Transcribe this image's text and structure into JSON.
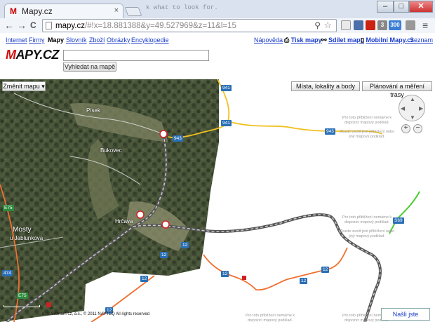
{
  "browser": {
    "tab_favicon": "M",
    "tab_title": "Mapy.cz",
    "tab_close": "×",
    "url_host": "mapy.cz",
    "url_rest": "/#!x=18.881388&y=49.527969&z=11&l=15",
    "win_min": "–",
    "win_max": "□",
    "win_close": "✕",
    "back": "←",
    "forward": "→",
    "reload": "C",
    "menu": "≡",
    "search_icon": "⚲",
    "star_icon": "☆",
    "overlay_text": "k what to look for.",
    "ext_badge_1": "3",
    "ext_badge_2": "300"
  },
  "site": {
    "nav": [
      "Internet",
      "Firmy",
      "Mapy",
      "Slovník",
      "Zboží",
      "Obrázky",
      "Encyklopedie"
    ],
    "right_links": [
      "Nápověda",
      "Tisk mapy",
      "Sdílet mapu",
      "Mobilní Mapy.cz",
      "Seznam"
    ],
    "logo_m": "M",
    "logo_rest": "APY.CZ",
    "search_placeholder": "",
    "search_button": "Vyhledat na mapě"
  },
  "map": {
    "change_map": "Změnit mapu",
    "places_button": "Místa, lokality a body",
    "routes_button": "Plánování a měření trasy",
    "labels": [
      "Písek",
      "Bukovec",
      "Hrčava",
      "Mosty",
      "u Jablunkova"
    ],
    "no_data_1": "Pro toto přiblížení nemáme k dispozici mapový podklad.",
    "no_data_2": "Zkuste zvolit jiné přiblížení nebo jiný mapový podklad.",
    "road_shields": [
      "941",
      "941",
      "943",
      "943",
      "E75",
      "474",
      "12",
      "12",
      "12",
      "12",
      "12",
      "12",
      "12",
      "S69",
      "E75"
    ],
    "copyright": "o, © Seznam cz, a.s., © 2011 NAVTEQ All rights reserved",
    "report_error": "Našli jste chybu?",
    "zoom_in": "+",
    "zoom_out": "−"
  },
  "colors": {
    "road_yellow": "#f0c020",
    "road_orange": "#f07030",
    "railway": "#555555",
    "border_green": "#4ccc30",
    "link_blue": "#1a3cc9"
  }
}
